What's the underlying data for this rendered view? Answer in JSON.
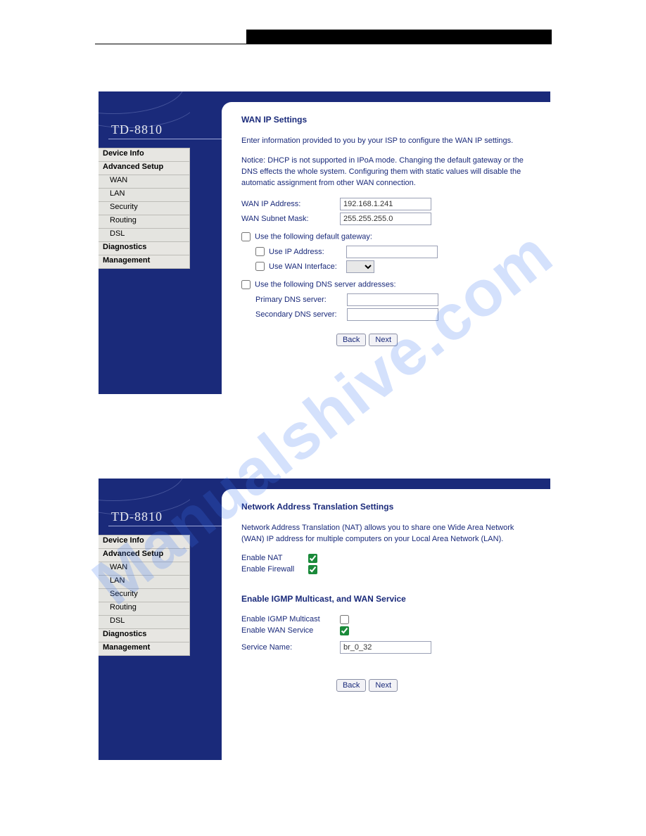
{
  "model": "TD-8810",
  "nav": {
    "main": [
      "Device Info",
      "Advanced Setup"
    ],
    "sub": [
      "WAN",
      "LAN",
      "Security",
      "Routing",
      "DSL"
    ],
    "tail": [
      "Diagnostics",
      "Management"
    ]
  },
  "buttons": {
    "back": "Back",
    "next": "Next"
  },
  "p1": {
    "title": "WAN IP Settings",
    "intro": "Enter information provided to you by your ISP to configure the WAN IP settings.",
    "notice": "Notice: DHCP is not supported in IPoA mode. Changing the default gateway or the DNS effects the whole system. Configuring them with static values will disable the automatic assignment from other WAN connection.",
    "ip_lbl": "WAN IP Address:",
    "ip_val": "192.168.1.241",
    "mask_lbl": "WAN Subnet Mask:",
    "mask_val": "255.255.255.0",
    "gw_chk": "Use the following default gateway:",
    "gw_ip": "Use IP Address:",
    "gw_wan": "Use WAN Interface:",
    "dns_chk": "Use the following DNS server addresses:",
    "dns1": "Primary DNS server:",
    "dns2": "Secondary DNS server:"
  },
  "p2": {
    "title": "Network Address Translation Settings",
    "intro": "Network Address Translation (NAT) allows you to share one Wide Area Network (WAN) IP address for multiple computers on your Local Area Network (LAN).",
    "nat": "Enable NAT",
    "fw": "Enable Firewall",
    "h2": "Enable IGMP Multicast, and WAN Service",
    "igmp": "Enable IGMP Multicast",
    "wan": "Enable WAN Service",
    "svc_lbl": "Service Name:",
    "svc_val": "br_0_32"
  },
  "wm": "Manualshive.com"
}
